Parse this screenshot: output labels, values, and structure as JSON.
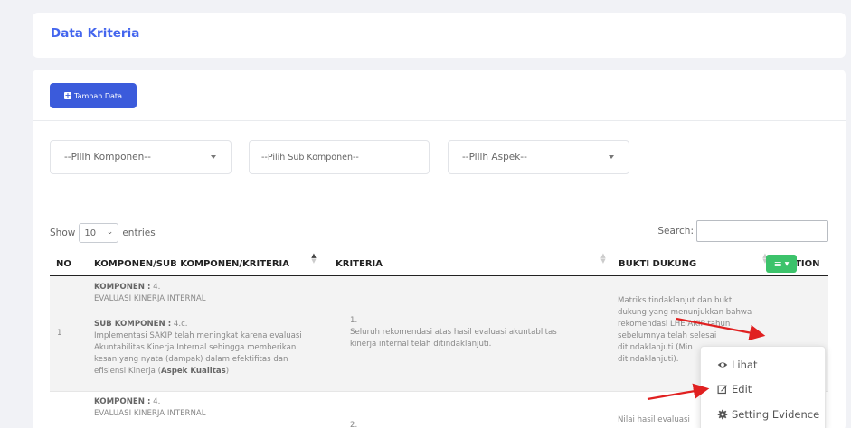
{
  "title_card": {
    "title": "Data Kriteria"
  },
  "toolbar": {
    "add_label": "Tambah Data"
  },
  "filters": {
    "komponen": "--Pilih Komponen--",
    "sub_komponen": "--Pilih Sub Komponen--",
    "aspek": "--Pilih Aspek--"
  },
  "table_controls": {
    "show_label": "Show",
    "page_length": "10",
    "entries_label": "entries",
    "search_label": "Search:"
  },
  "columns": [
    "NO",
    "KOMPONEN/SUB KOMPONEN/KRITERIA",
    "KRITERIA",
    "BUKTI DUKUNG",
    "ACTION"
  ],
  "rows": [
    {
      "no": "1",
      "komponen_label": "KOMPONEN :",
      "komponen_num": " 4.",
      "komponen_name": "EVALUASI KINERJA INTERNAL",
      "sub_label": "SUB KOMPONEN :",
      "sub_num": " 4.c.",
      "sub_desc": [
        "Implementasi SAKIP telah meningkat karena evaluasi",
        "Akuntabilitas Kinerja Internal sehingga memberikan",
        "kesan yang nyata (dampak) dalam efektifitas dan"
      ],
      "sub_desc_last": "efisiensi Kinerja (",
      "aspek": "Aspek Kualitas",
      "close_paren": ")",
      "kriteria_num": "1.",
      "kriteria_text": [
        "Seluruh rekomendasi atas hasil evaluasi akuntablitas",
        "kinerja internal telah ditindaklanjuti."
      ],
      "bukti_text": [
        "Matriks tindaklanjut dan bukti",
        "dukung yang menunjukkan bahwa",
        "rekomendasi LHE AKIP tahun",
        "sebelumnya telah selesai",
        "ditindaklanjuti (Min",
        "ditindaklanjuti)."
      ]
    },
    {
      "komponen_label": "KOMPONEN :",
      "komponen_num": " 4.",
      "komponen_name": "EVALUASI KINERJA INTERNAL",
      "kriteria_num": "2.",
      "bukti_text": [
        "Nilai hasil evaluasi"
      ]
    }
  ],
  "action_menu": {
    "items": [
      {
        "label": "Lihat",
        "icon": "eye-icon"
      },
      {
        "label": "Edit",
        "icon": "edit-icon"
      },
      {
        "label": "Setting Evidence",
        "icon": "gear-icon"
      }
    ]
  },
  "colors": {
    "accent": "#3b5bdb",
    "title": "#4466ee",
    "action_green": "#3cc36b",
    "annotation_arrow": "#e02020"
  }
}
